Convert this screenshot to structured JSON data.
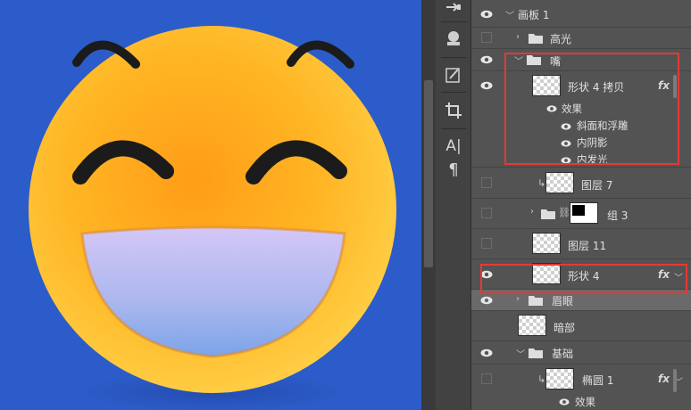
{
  "canvas": {
    "background": "#2c5cc9",
    "face_color": "#ffb21a",
    "mouth_color": "#c3c0f0"
  },
  "tools": [
    {
      "icon": "pen-arrow-icon"
    },
    {
      "icon": "stamp-icon"
    },
    {
      "icon": "brush-panel-icon"
    },
    {
      "icon": "crop-icon"
    },
    {
      "icon": "character-icon",
      "text": "A|"
    },
    {
      "icon": "paragraph-icon",
      "text": "¶"
    }
  ],
  "layers": {
    "artboard": "画板 1",
    "highlight": "高光",
    "mouth": "嘴",
    "shape4copy": "形状 4 拷贝",
    "effects": "效果",
    "bevel": "斜面和浮雕",
    "inner_shadow": "内阴影",
    "inner_glow": "内发光",
    "layer7": "图层 7",
    "group3": "组 3",
    "layer11": "图层 11",
    "shape4": "形状 4",
    "eyebrow_eye": "眉眼",
    "dark_part": "暗部",
    "base": "基础",
    "ellipse1": "椭圆 1",
    "effects2": "效果",
    "fx_label": "fx"
  },
  "colors": {
    "highlight_box": "#e53935",
    "panel_bg": "#535353"
  }
}
